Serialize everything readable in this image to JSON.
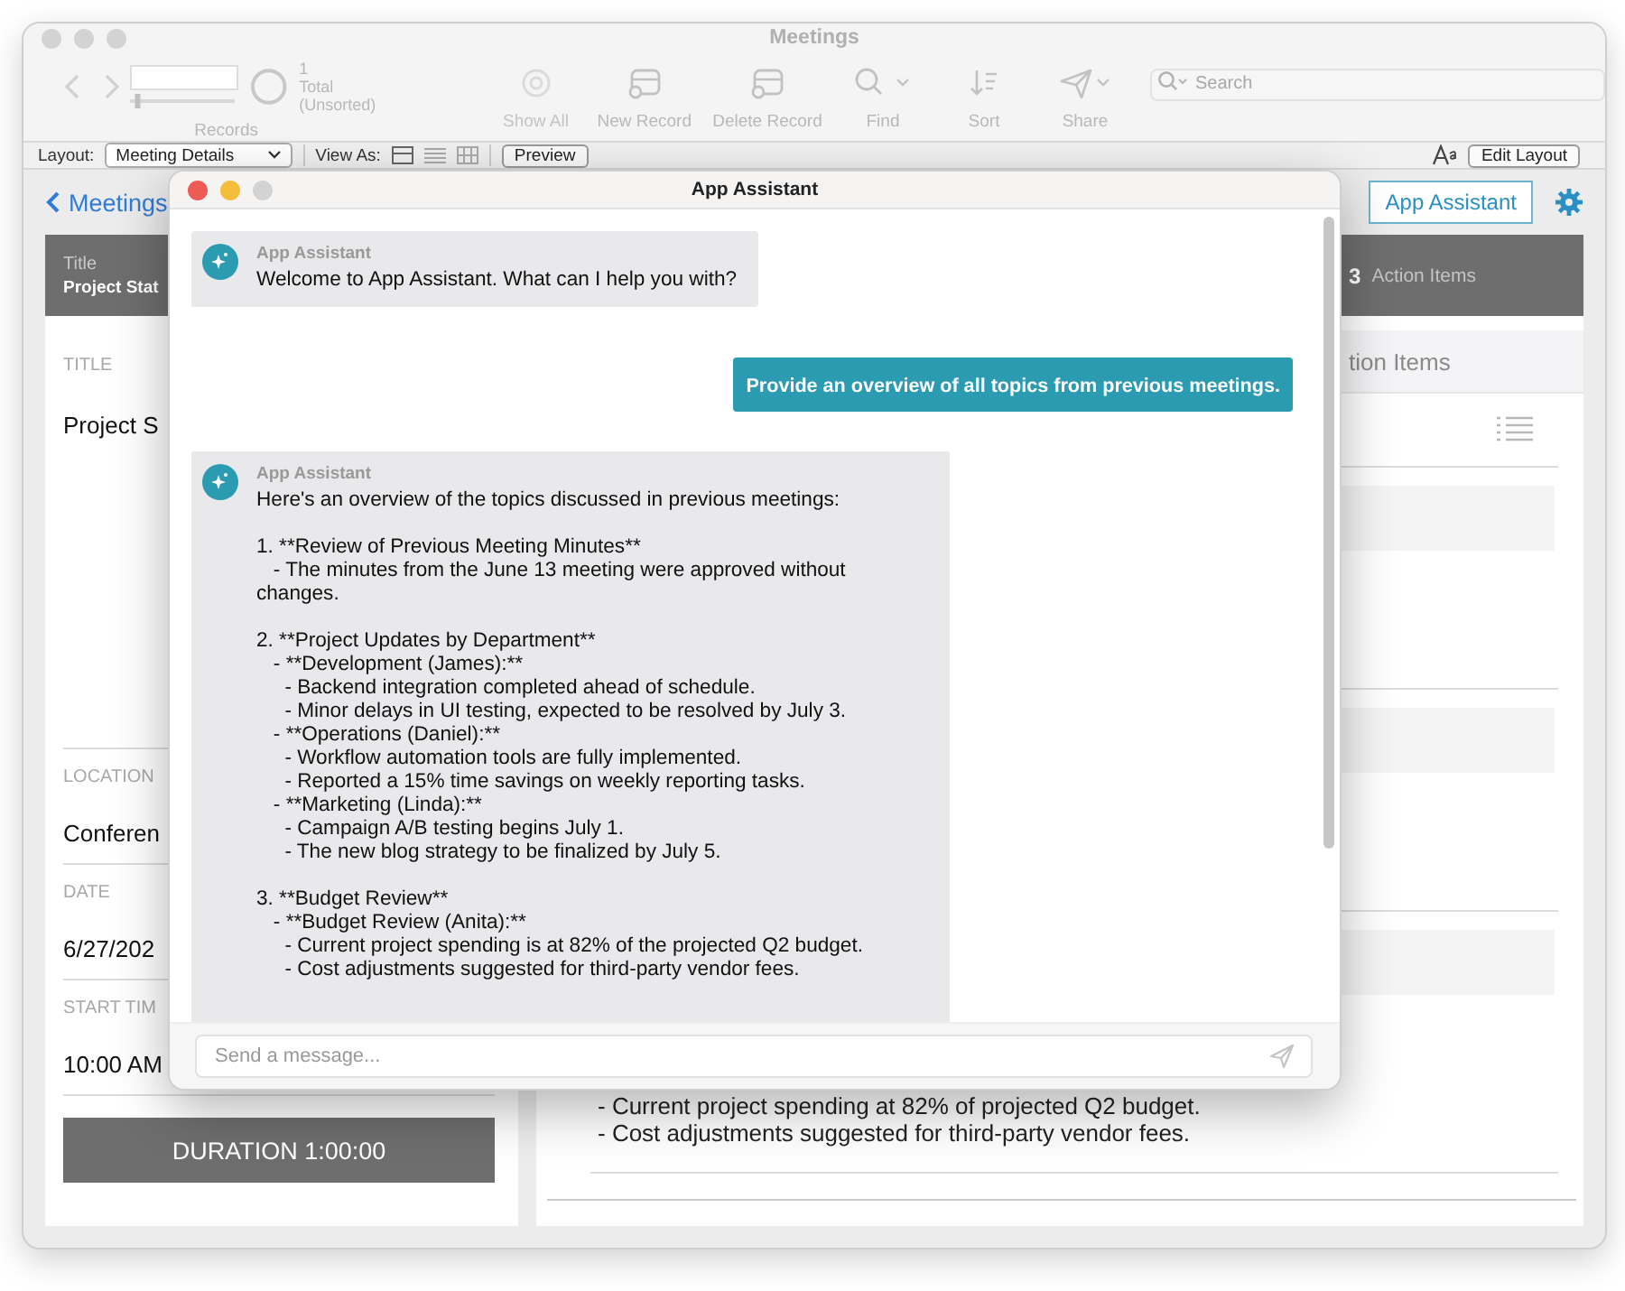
{
  "window": {
    "title": "Meetings"
  },
  "toolbar": {
    "record_slider": {
      "level": 0.05
    },
    "found_count": "1",
    "found_label": "Total (Unsorted)",
    "records_label": "Records",
    "actions": [
      {
        "kind": "showall",
        "label": "Show All",
        "disabled": true
      },
      {
        "kind": "new",
        "label": "New Record",
        "disabled": false
      },
      {
        "kind": "delete",
        "label": "Delete Record",
        "disabled": false
      },
      {
        "kind": "find",
        "label": "Find",
        "disabled": false
      },
      {
        "kind": "sort",
        "label": "Sort",
        "disabled": false
      },
      {
        "kind": "share",
        "label": "Share",
        "disabled": false
      }
    ],
    "search": {
      "placeholder": "Search"
    }
  },
  "layout_bar": {
    "layout_label": "Layout:",
    "layout_value": "Meeting Details",
    "view_as_label": "View As:",
    "preview": "Preview",
    "edit_layout": "Edit Layout"
  },
  "nav": {
    "back": "Meetings",
    "assistant_button": "App Assistant"
  },
  "record_panel": {
    "header_label": "Title",
    "header_value": "Project Stat",
    "fields": [
      {
        "kind": "tall",
        "label": "TITLE",
        "value": "Project S"
      },
      {
        "kind": "line",
        "label": "LOCATION",
        "value": "Conferen"
      },
      {
        "kind": "line",
        "label": "DATE",
        "value": "6/27/202"
      },
      {
        "kind": "line",
        "label": "START TIM",
        "value": "10:00 AM"
      }
    ],
    "duration": "DURATION 1:00:00"
  },
  "action_panel": {
    "count": "3",
    "title": "Action Items",
    "tab": "tion Items",
    "lines": [
      "- Current project spending at 82% of projected Q2 budget.",
      "- Cost adjustments suggested for third-party vendor fees."
    ]
  },
  "assistant": {
    "title": "App Assistant",
    "messages": [
      {
        "kind": "assistant",
        "sender": "App Assistant",
        "text": "Welcome to App Assistant. What can I help you with?"
      },
      {
        "kind": "user",
        "text": "Provide an overview of all topics from previous meetings."
      },
      {
        "kind": "assistant",
        "sender": "App Assistant",
        "text": "Here's an overview of the topics discussed in previous meetings:\n\n1. **Review of Previous Meeting Minutes**\n   - The minutes from the June 13 meeting were approved without changes.\n\n2. **Project Updates by Department**\n   - **Development (James):**\n     - Backend integration completed ahead of schedule.\n     - Minor delays in UI testing, expected to be resolved by July 3.\n   - **Operations (Daniel):**\n     - Workflow automation tools are fully implemented.\n     - Reported a 15% time savings on weekly reporting tasks.\n   - **Marketing (Linda):**\n     - Campaign A/B testing begins July 1.\n     - The new blog strategy to be finalized by July 5.\n\n3. **Budget Review**\n   - **Budget Review (Anita):**\n     - Current project spending is at 82% of the projected Q2 budget.\n     - Cost adjustments suggested for third-party vendor fees."
      }
    ],
    "input": {
      "placeholder": "Send a message..."
    }
  }
}
